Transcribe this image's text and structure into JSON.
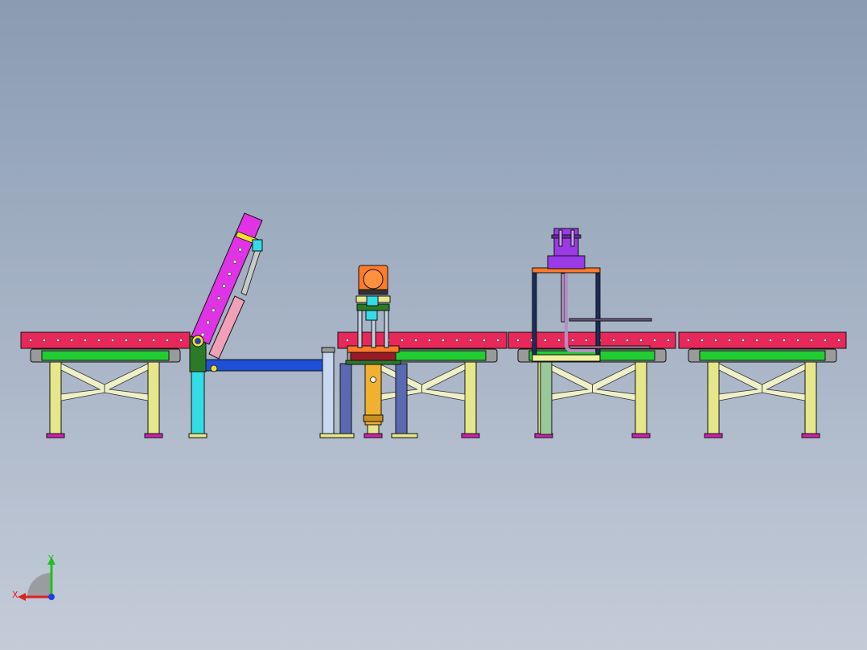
{
  "viewport": {
    "background_top": "#8a9cb2",
    "background_bottom": "#c4ccd8"
  },
  "model": {
    "colors": {
      "conveyor_rail": "#e8285a",
      "roller_bed": "#22cc33",
      "leg": "#e6e68a",
      "brace": "#f0f0c8",
      "foot": "#cc22aa",
      "tilt_arm": "#e033e6",
      "cylinder": "#f0a0b8",
      "beam": "#1f4fd6",
      "post_cyan": "#33dde6",
      "bracket_green": "#2a7a2a",
      "motor_orange": "#ff7a2a",
      "lift_cylinder": "#f0b030",
      "frame_navy": "#1a2e5a",
      "press_purple": "#9a3ae6",
      "plate_orange": "#ff7a2a",
      "plate_dark": "#9a1a2a"
    }
  },
  "triad": {
    "x_label": "X",
    "y_label": "Y",
    "x_color": "#e02020",
    "y_color": "#20c020",
    "z_color": "#2040e0"
  }
}
